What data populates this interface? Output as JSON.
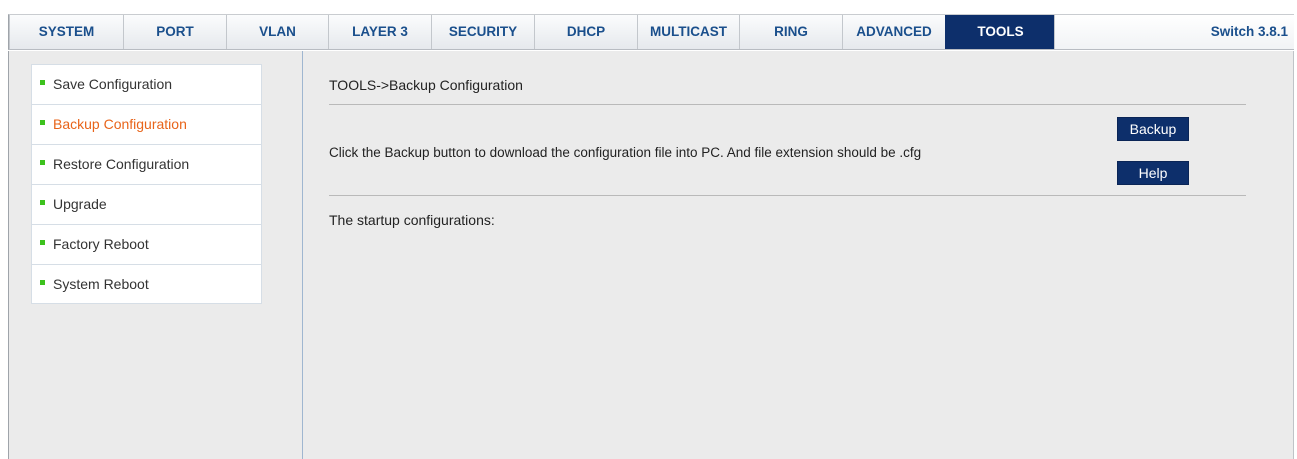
{
  "nav": {
    "tabs": [
      {
        "label": "SYSTEM"
      },
      {
        "label": "PORT"
      },
      {
        "label": "VLAN"
      },
      {
        "label": "LAYER 3"
      },
      {
        "label": "SECURITY"
      },
      {
        "label": "DHCP"
      },
      {
        "label": "MULTICAST"
      },
      {
        "label": "RING"
      },
      {
        "label": "ADVANCED"
      },
      {
        "label": "TOOLS"
      }
    ],
    "active_tab": "TOOLS",
    "version": "Switch 3.8.1"
  },
  "sidebar": {
    "items": [
      {
        "label": "Save Configuration"
      },
      {
        "label": "Backup Configuration"
      },
      {
        "label": "Restore Configuration"
      },
      {
        "label": "Upgrade"
      },
      {
        "label": "Factory Reboot"
      },
      {
        "label": "System Reboot"
      }
    ],
    "active_item": "Backup Configuration"
  },
  "main": {
    "breadcrumb": "TOOLS->Backup Configuration",
    "description": "Click the Backup button to download the configuration file into PC. And file extension should be .cfg",
    "backup_label": "Backup",
    "help_label": "Help",
    "startup_label": "The startup configurations:"
  },
  "colors": {
    "active_tab_bg": "#0d2f6b",
    "tab_text": "#1a4f8c",
    "active_sidebar_text": "#e8641a",
    "bullet": "#3cc21d",
    "button_bg": "#0d2f6b",
    "content_bg": "#ebebeb"
  }
}
